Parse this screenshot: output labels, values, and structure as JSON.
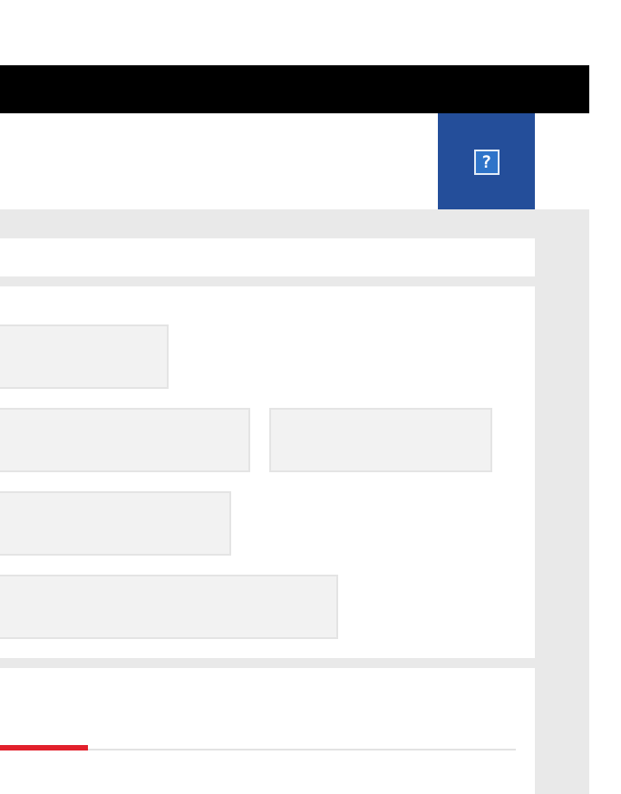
{
  "header": {
    "help_icon": "help-icon",
    "help_label": "?",
    "help_panel_color": "#244e9a",
    "help_icon_color": "#2f74c9"
  },
  "form": {
    "fields": [
      {
        "name": "field-1",
        "value": ""
      },
      {
        "name": "field-2",
        "value": ""
      },
      {
        "name": "field-3",
        "value": ""
      },
      {
        "name": "field-4",
        "value": ""
      },
      {
        "name": "field-5",
        "value": ""
      }
    ]
  },
  "progress": {
    "fraction": 0.17,
    "fill_color": "#e2202b"
  }
}
